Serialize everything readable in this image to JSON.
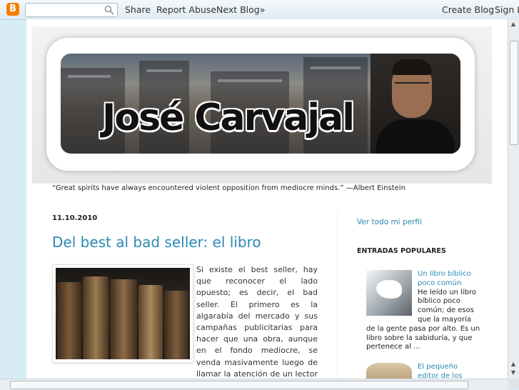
{
  "navbar": {
    "logo": "B",
    "share": "Share",
    "report_abuse": "Report Abuse",
    "next_blog": "Next Blog»",
    "create_blog": "Create Blog",
    "sign_in": "Sign In"
  },
  "header": {
    "banner_title": "José Carvajal",
    "description": "“Great spirits have always encountered violent opposition from mediocre minds.” —Albert Einstein"
  },
  "post": {
    "date": "11.10.2010",
    "title": "Del best al bad seller: el libro",
    "body": "Si existe el best seller, hay que reconocer el lado opuesto; es decir, el bad seller. El primero es la algarabía del mercado y sus campañas publicitarias para hacer que una obra, aunque en el fondo mediocre, se venda masivamente luego de llamar la atención de un lector mediático que por lo general no exige calidad; el segundo es sin duda alguna la"
  },
  "sidebar": {
    "profile_link": "Ver todo mi perfil",
    "popular_title": "ENTRADAS POPULARES",
    "popular": [
      {
        "title": "Un libro bíblico poco común",
        "snippet": "He leído un libro bíblico poco común; de esos que la mayoría de la gente pasa por alto. Es un libro sobre la sabiduría, y que pertenece al ..."
      },
      {
        "title": "El pequeño editor de los"
      }
    ]
  }
}
